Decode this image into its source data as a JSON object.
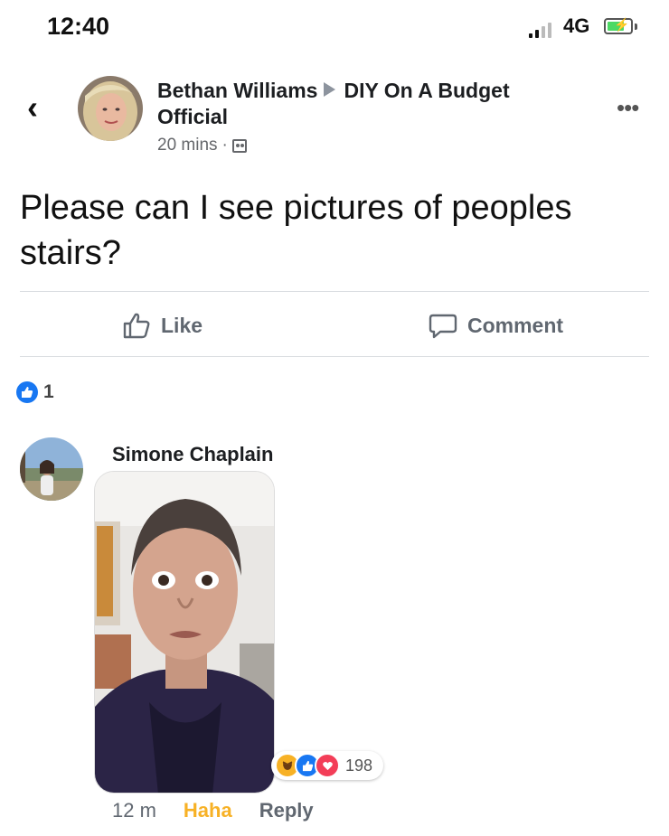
{
  "status_bar": {
    "time": "12:40",
    "network": "4G"
  },
  "post": {
    "author": "Bethan Williams",
    "group": "DIY On A Budget Official",
    "timestamp": "20 mins",
    "text": "Please can I see pictures of peoples stairs?",
    "actions": {
      "like_label": "Like",
      "comment_label": "Comment"
    },
    "reaction_count": "1"
  },
  "comment": {
    "author": "Simone Chaplain",
    "reactions_total": "198",
    "age": "12 m",
    "my_reaction": "Haha",
    "reply_label": "Reply"
  },
  "colors": {
    "facebook_blue": "#1877f2",
    "haha_yellow": "#f7b125",
    "love_red": "#f33e58",
    "secondary_text": "#65676b"
  }
}
